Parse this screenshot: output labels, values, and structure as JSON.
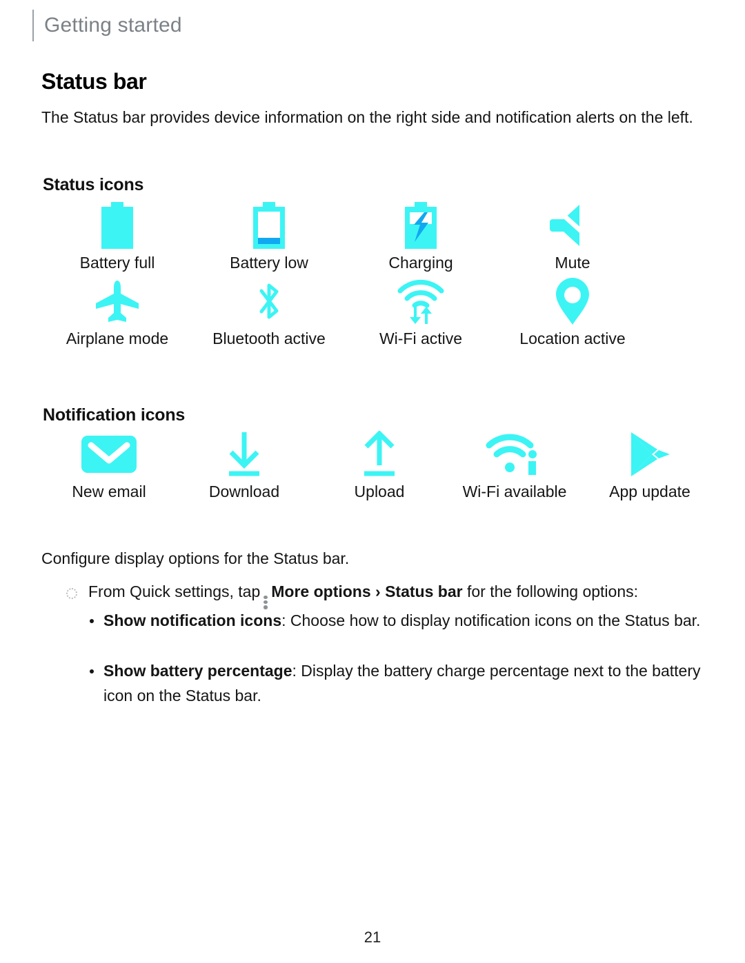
{
  "header": {
    "title": "Getting started"
  },
  "section": {
    "title": "Status bar",
    "intro": "The Status bar provides device information on the right side and notification alerts on the left.",
    "configure": "Configure display options for the Status bar."
  },
  "status_icons": {
    "heading": "Status icons",
    "items": [
      {
        "icon": "battery-full-icon",
        "label": "Battery full"
      },
      {
        "icon": "battery-low-icon",
        "label": "Battery low"
      },
      {
        "icon": "charging-icon",
        "label": "Charging"
      },
      {
        "icon": "mute-icon",
        "label": "Mute"
      },
      {
        "icon": "airplane-mode-icon",
        "label": "Airplane mode"
      },
      {
        "icon": "bluetooth-icon",
        "label": "Bluetooth active"
      },
      {
        "icon": "wifi-active-icon",
        "label": "Wi-Fi active"
      },
      {
        "icon": "location-icon",
        "label": "Location active"
      }
    ]
  },
  "notification_icons": {
    "heading": "Notification icons",
    "items": [
      {
        "icon": "new-email-icon",
        "label": "New email"
      },
      {
        "icon": "download-icon",
        "label": "Download"
      },
      {
        "icon": "upload-icon",
        "label": "Upload"
      },
      {
        "icon": "wifi-available-icon",
        "label": "Wi-Fi available"
      },
      {
        "icon": "app-update-icon",
        "label": "App update"
      }
    ]
  },
  "instructions": {
    "quick_settings": {
      "lead": "From Quick settings, tap",
      "more_options": "More options",
      "separator": "›",
      "target": "Status bar",
      "trailing": "for the following options:"
    },
    "options": [
      {
        "term": "Show notification icons",
        "description": ": Choose how to display notification icons on the Status bar."
      },
      {
        "term": "Show battery percentage",
        "description": ": Display the battery charge percentage next to the battery icon on the Status bar."
      }
    ]
  },
  "footer": {
    "page_number": "21"
  },
  "colors": {
    "icon_cyan": "#3CF4F4",
    "icon_blue": "#11A8F0",
    "header_gray": "#7b8186",
    "bullet_gray": "#8d9295"
  }
}
